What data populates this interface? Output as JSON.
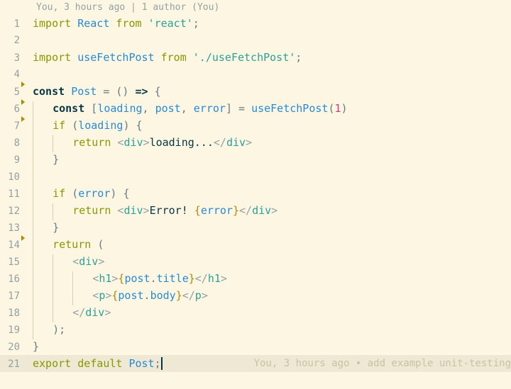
{
  "blame_header": "You, 3 hours ago | 1 author (You)",
  "blame_inline": "You, 3 hours ago • add example unit-testing",
  "fold_markers_at": [
    4,
    5,
    6,
    13
  ],
  "highlighted_line": 21,
  "lines": [
    {
      "n": 1,
      "tokens": [
        [
          "kw",
          "import"
        ],
        [
          "plain",
          " "
        ],
        [
          "fn",
          "React"
        ],
        [
          "plain",
          " "
        ],
        [
          "kw",
          "from"
        ],
        [
          "plain",
          " "
        ],
        [
          "str",
          "'react'"
        ],
        [
          "punc",
          ";"
        ]
      ]
    },
    {
      "n": 2,
      "tokens": []
    },
    {
      "n": 3,
      "tokens": [
        [
          "kw",
          "import"
        ],
        [
          "plain",
          " "
        ],
        [
          "fn",
          "useFetchPost"
        ],
        [
          "plain",
          " "
        ],
        [
          "kw",
          "from"
        ],
        [
          "plain",
          " "
        ],
        [
          "str",
          "'./useFetchPost'"
        ],
        [
          "punc",
          ";"
        ]
      ]
    },
    {
      "n": 4,
      "tokens": []
    },
    {
      "n": 5,
      "tokens": [
        [
          "kw2",
          "const"
        ],
        [
          "plain",
          " "
        ],
        [
          "fn",
          "Post"
        ],
        [
          "plain",
          " "
        ],
        [
          "punc",
          "="
        ],
        [
          "plain",
          " "
        ],
        [
          "punc",
          "()"
        ],
        [
          "plain",
          " "
        ],
        [
          "kw2",
          "=>"
        ],
        [
          "plain",
          " "
        ],
        [
          "punc",
          "{"
        ]
      ]
    },
    {
      "n": 6,
      "indent": 1,
      "tokens": [
        [
          "kw2",
          "const"
        ],
        [
          "plain",
          " "
        ],
        [
          "punc",
          "["
        ],
        [
          "attr",
          "loading"
        ],
        [
          "punc",
          ","
        ],
        [
          "plain",
          " "
        ],
        [
          "attr",
          "post"
        ],
        [
          "punc",
          ","
        ],
        [
          "plain",
          " "
        ],
        [
          "attr",
          "error"
        ],
        [
          "punc",
          "]"
        ],
        [
          "plain",
          " "
        ],
        [
          "punc",
          "="
        ],
        [
          "plain",
          " "
        ],
        [
          "fn",
          "useFetchPost"
        ],
        [
          "punc",
          "("
        ],
        [
          "num",
          "1"
        ],
        [
          "punc",
          ")"
        ]
      ]
    },
    {
      "n": 7,
      "indent": 1,
      "tokens": [
        [
          "kw",
          "if"
        ],
        [
          "plain",
          " "
        ],
        [
          "punc",
          "("
        ],
        [
          "attr",
          "loading"
        ],
        [
          "punc",
          ")"
        ],
        [
          "plain",
          " "
        ],
        [
          "punc",
          "{"
        ]
      ]
    },
    {
      "n": 8,
      "indent": 2,
      "tokens": [
        [
          "kw",
          "return"
        ],
        [
          "plain",
          " "
        ],
        [
          "tagp",
          "<"
        ],
        [
          "tag",
          "div"
        ],
        [
          "tagp",
          ">"
        ],
        [
          "plain",
          "loading..."
        ],
        [
          "tagp",
          "</"
        ],
        [
          "tag",
          "div"
        ],
        [
          "tagp",
          ">"
        ]
      ]
    },
    {
      "n": 9,
      "indent": 1,
      "tokens": [
        [
          "punc",
          "}"
        ]
      ]
    },
    {
      "n": 10,
      "indent": 0,
      "guide": 1,
      "tokens": []
    },
    {
      "n": 11,
      "indent": 1,
      "tokens": [
        [
          "kw",
          "if"
        ],
        [
          "plain",
          " "
        ],
        [
          "punc",
          "("
        ],
        [
          "attr",
          "error"
        ],
        [
          "punc",
          ")"
        ],
        [
          "plain",
          " "
        ],
        [
          "punc",
          "{"
        ]
      ]
    },
    {
      "n": 12,
      "indent": 2,
      "tokens": [
        [
          "kw",
          "return"
        ],
        [
          "plain",
          " "
        ],
        [
          "tagp",
          "<"
        ],
        [
          "tag",
          "div"
        ],
        [
          "tagp",
          ">"
        ],
        [
          "plain",
          "Error! "
        ],
        [
          "jsx",
          "{"
        ],
        [
          "attr",
          "error"
        ],
        [
          "jsx",
          "}"
        ],
        [
          "tagp",
          "</"
        ],
        [
          "tag",
          "div"
        ],
        [
          "tagp",
          ">"
        ]
      ]
    },
    {
      "n": 13,
      "indent": 1,
      "tokens": [
        [
          "punc",
          "}"
        ]
      ]
    },
    {
      "n": 14,
      "indent": 1,
      "tokens": [
        [
          "kw",
          "return"
        ],
        [
          "plain",
          " "
        ],
        [
          "punc",
          "("
        ]
      ]
    },
    {
      "n": 15,
      "indent": 2,
      "tokens": [
        [
          "tagp",
          "<"
        ],
        [
          "tag",
          "div"
        ],
        [
          "tagp",
          ">"
        ]
      ]
    },
    {
      "n": 16,
      "indent": 3,
      "tokens": [
        [
          "tagp",
          "<"
        ],
        [
          "tag",
          "h1"
        ],
        [
          "tagp",
          ">"
        ],
        [
          "jsx",
          "{"
        ],
        [
          "attr",
          "post"
        ],
        [
          "punc",
          "."
        ],
        [
          "attr",
          "title"
        ],
        [
          "jsx",
          "}"
        ],
        [
          "tagp",
          "</"
        ],
        [
          "tag",
          "h1"
        ],
        [
          "tagp",
          ">"
        ]
      ]
    },
    {
      "n": 17,
      "indent": 3,
      "tokens": [
        [
          "tagp",
          "<"
        ],
        [
          "tag",
          "p"
        ],
        [
          "tagp",
          ">"
        ],
        [
          "jsx",
          "{"
        ],
        [
          "attr",
          "post"
        ],
        [
          "punc",
          "."
        ],
        [
          "attr",
          "body"
        ],
        [
          "jsx",
          "}"
        ],
        [
          "tagp",
          "</"
        ],
        [
          "tag",
          "p"
        ],
        [
          "tagp",
          ">"
        ]
      ]
    },
    {
      "n": 18,
      "indent": 2,
      "tokens": [
        [
          "tagp",
          "</"
        ],
        [
          "tag",
          "div"
        ],
        [
          "tagp",
          ">"
        ]
      ]
    },
    {
      "n": 19,
      "indent": 1,
      "tokens": [
        [
          "punc",
          ");"
        ]
      ]
    },
    {
      "n": 20,
      "indent": 0,
      "tokens": [
        [
          "punc",
          "}"
        ]
      ]
    },
    {
      "n": 21,
      "indent": 0,
      "tokens": [
        [
          "kw",
          "export"
        ],
        [
          "plain",
          " "
        ],
        [
          "kw",
          "default"
        ],
        [
          "plain",
          " "
        ],
        [
          "fn",
          "Post"
        ],
        [
          "punc",
          ";"
        ]
      ]
    }
  ]
}
